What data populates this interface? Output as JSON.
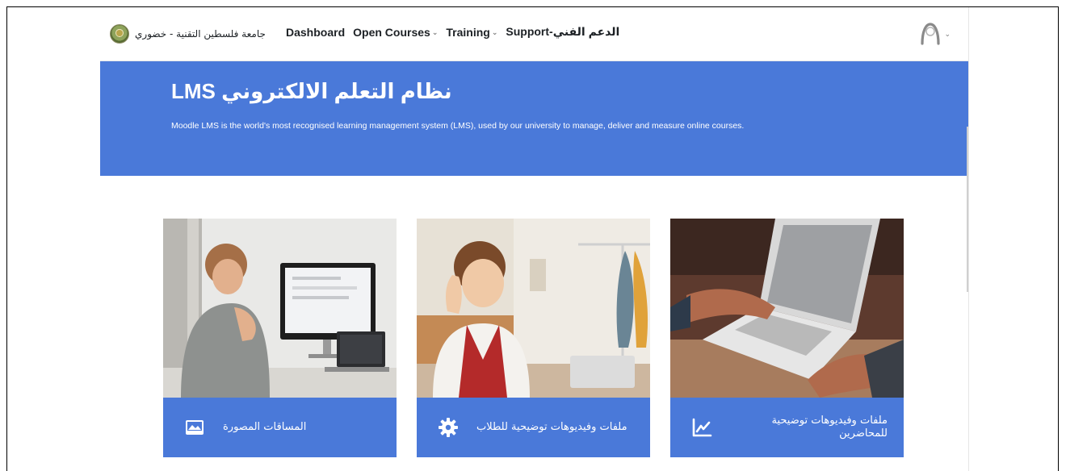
{
  "navbar": {
    "brand_name": "جامعة فلسطين التقنية - خضوري",
    "links": [
      {
        "label": "Dashboard",
        "has_dropdown": false
      },
      {
        "label": "Open Courses",
        "has_dropdown": true
      },
      {
        "label": "Training",
        "has_dropdown": true
      },
      {
        "label": "Support-الدعم الفني",
        "has_dropdown": false
      }
    ],
    "user_icon": "user-avatar-icon"
  },
  "hero": {
    "title": "LMS نظام التعلم الالكتروني",
    "description": "Moodle LMS is the world's most recognised learning management system (LMS), used by our university to manage, deliver and measure online courses."
  },
  "cards": [
    {
      "label": "المساقات المصورة",
      "icon": "video-gallery-icon"
    },
    {
      "label": "ملفات وفيديوهات توضيحية للطلاب",
      "icon": "gear-icon"
    },
    {
      "label": "ملفات وفيديوهات توضيحية للمحاضرين",
      "icon": "line-chart-icon"
    }
  ],
  "colors": {
    "hero_bg": "#4a79d9",
    "card_footer_bg": "#4a79d9"
  }
}
